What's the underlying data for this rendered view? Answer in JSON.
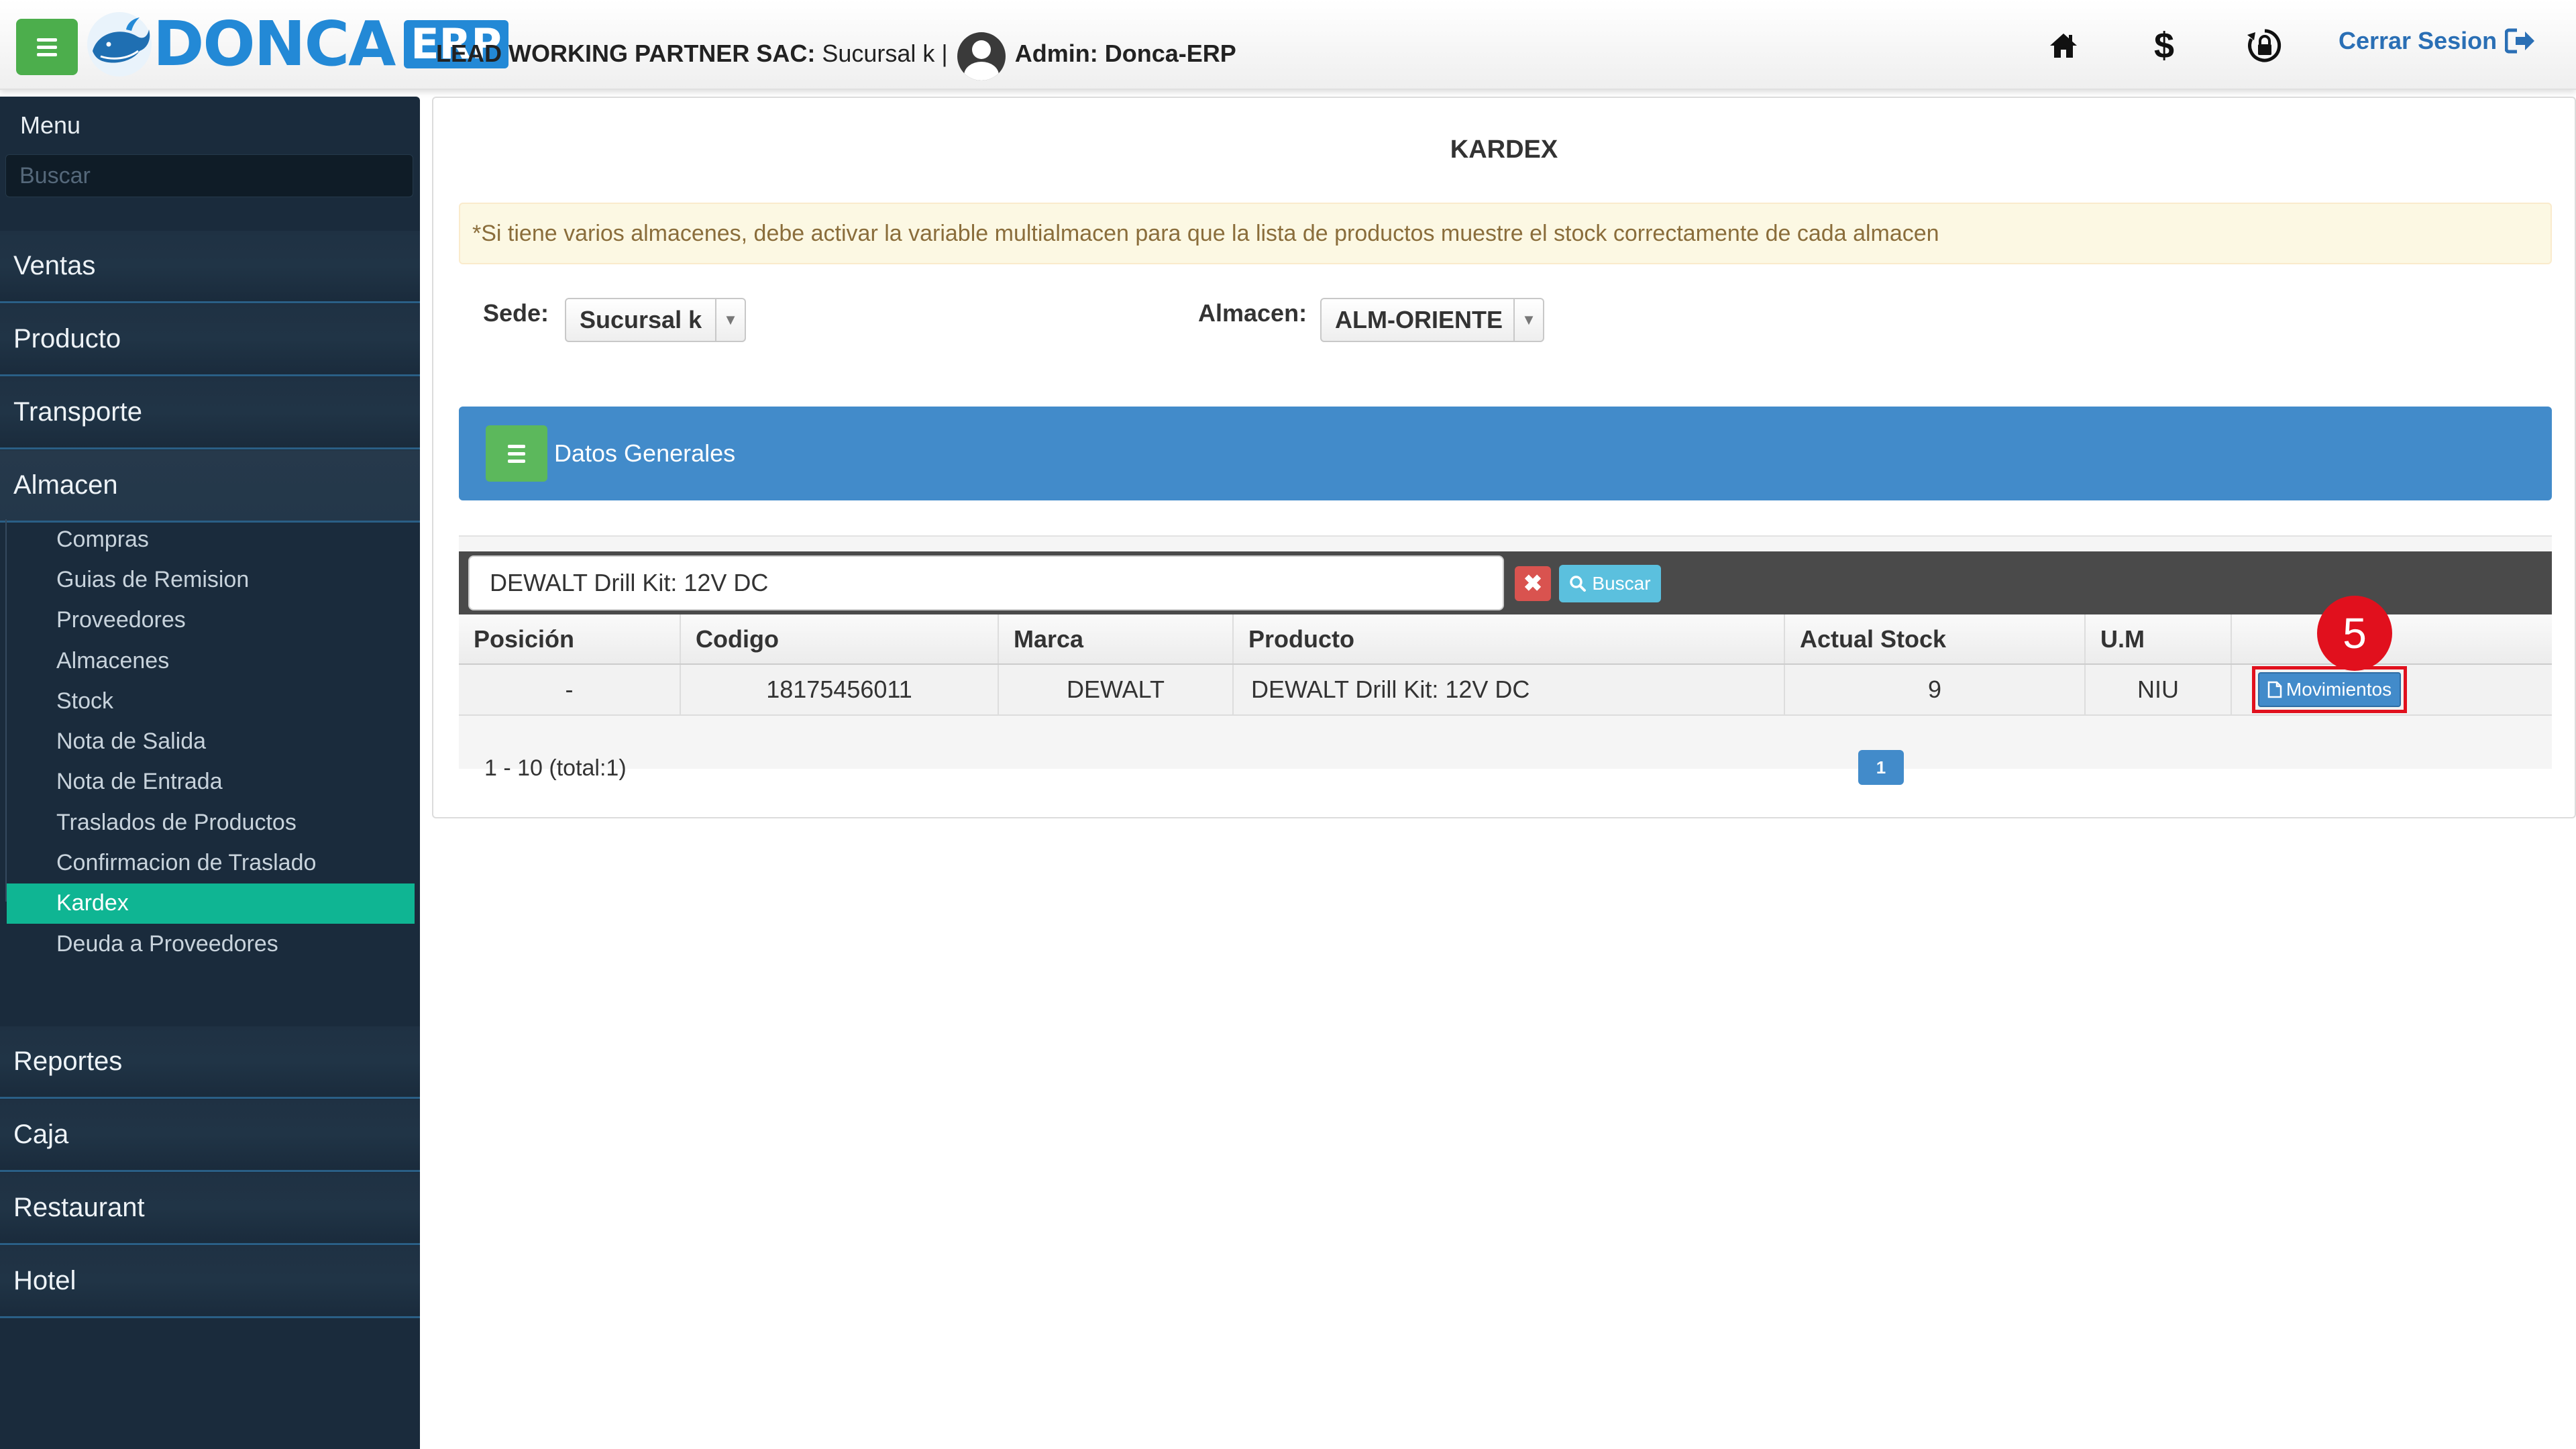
{
  "header": {
    "logo_text": "DONCA",
    "logo_badge": "ERP",
    "company_name": "LEAD WORKING PARTNER SAC:",
    "branch": " Sucursal k |",
    "admin_label": "Admin: Donca-ERP",
    "logout_label": "Cerrar Sesion",
    "icons": [
      "home-icon",
      "dollar-icon",
      "lock-sync-icon",
      "logout-icon"
    ]
  },
  "sidebar": {
    "title": "Menu",
    "search_placeholder": "Buscar",
    "items": [
      {
        "label": "Ventas"
      },
      {
        "label": "Producto"
      },
      {
        "label": "Transporte"
      },
      {
        "label": "Almacen"
      },
      {
        "label": "Reportes"
      },
      {
        "label": "Caja"
      },
      {
        "label": "Restaurant"
      },
      {
        "label": "Hotel"
      }
    ],
    "almacen_sub": [
      {
        "label": "Compras"
      },
      {
        "label": "Guias de Remision"
      },
      {
        "label": "Proveedores"
      },
      {
        "label": "Almacenes"
      },
      {
        "label": "Stock"
      },
      {
        "label": "Nota de Salida"
      },
      {
        "label": "Nota de Entrada"
      },
      {
        "label": "Traslados de Productos"
      },
      {
        "label": "Confirmacion de Traslado"
      },
      {
        "label": "Kardex",
        "active": true
      },
      {
        "label": "Deuda a Proveedores"
      }
    ]
  },
  "main": {
    "title": "KARDEX",
    "warning": "*Si tiene varios almacenes, debe activar la variable multialmacen para que la lista de productos muestre el stock correctamente de cada almacen",
    "sede_label": "Sede:",
    "sede_value": "Sucursal k",
    "almacen_label": "Almacen:",
    "almacen_value": "ALM-ORIENTE",
    "section_title": "Datos Generales",
    "search_value": "DEWALT Drill Kit: 12V DC",
    "search_button": "Buscar",
    "columns": [
      "Posición",
      "Codigo",
      "Marca",
      "Producto",
      "Actual Stock",
      "U.M",
      ""
    ],
    "rows": [
      {
        "posicion": "-",
        "codigo": "18175456011",
        "marca": "DEWALT",
        "producto": "DEWALT Drill Kit: 12V DC",
        "stock": "9",
        "um": "NIU",
        "action": "Movimientos"
      }
    ],
    "pager_text": "1 - 10 (total:1)",
    "current_page": "1",
    "step_badge": "5"
  },
  "colors": {
    "brand_blue": "#2389d6",
    "sidebar_bg": "#1a2b3c",
    "active_item": "#0fb593",
    "section_bar": "#428bca",
    "highlight_red": "#e1101d"
  }
}
